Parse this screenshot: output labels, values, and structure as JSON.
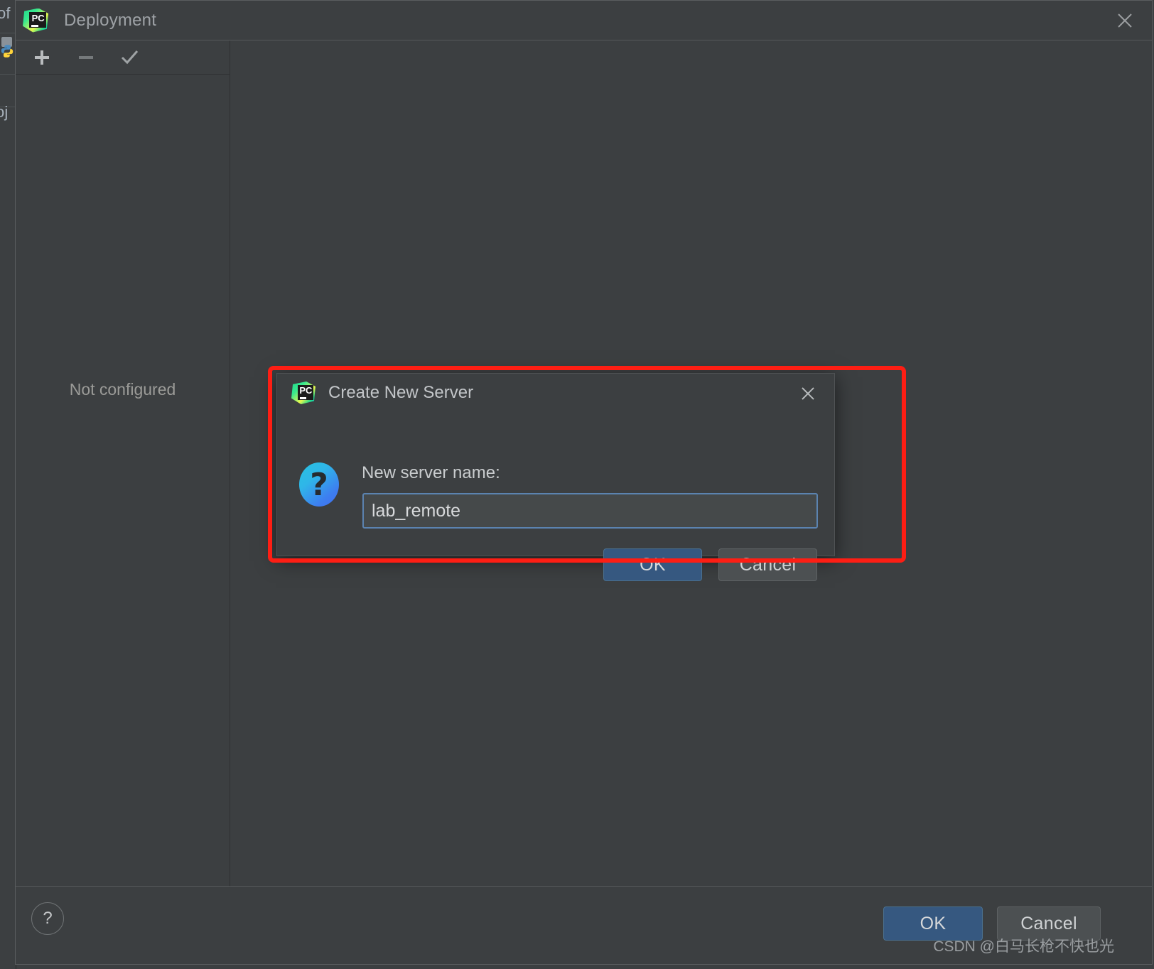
{
  "backdrop": {
    "fragment_top": "of",
    "fragment_mid": "oj"
  },
  "deployment_window": {
    "title": "Deployment",
    "app_icon": "pycharm-icon",
    "close_icon": "close-icon",
    "toolbar": {
      "add_label": "+",
      "remove_label": "−",
      "apply_label": "✓",
      "add_icon": "plus-icon",
      "remove_icon": "minus-icon",
      "apply_icon": "check-icon"
    },
    "servers_list": {
      "empty_text": "Not configured"
    },
    "footer": {
      "help_label": "?",
      "help_icon": "question-mark-icon",
      "ok_label": "OK",
      "cancel_label": "Cancel"
    }
  },
  "dialog": {
    "title": "Create New Server",
    "app_icon": "pycharm-icon",
    "close_icon": "close-icon",
    "question_icon": "question-mark-icon",
    "question_glyph": "?",
    "field_label": "New server name:",
    "field_value": "lab_remote",
    "field_placeholder": "",
    "ok_label": "OK",
    "cancel_label": "Cancel"
  },
  "annotation": {
    "highlight_color": "#fd1e14"
  },
  "watermark": {
    "text": "CSDN @白马长枪不快也光"
  },
  "colors": {
    "window_bg": "#3c3f41",
    "accent_blue": "#365880",
    "input_border": "#5b83b0",
    "text_primary": "#c9ccce",
    "text_muted": "#9b9b98"
  }
}
